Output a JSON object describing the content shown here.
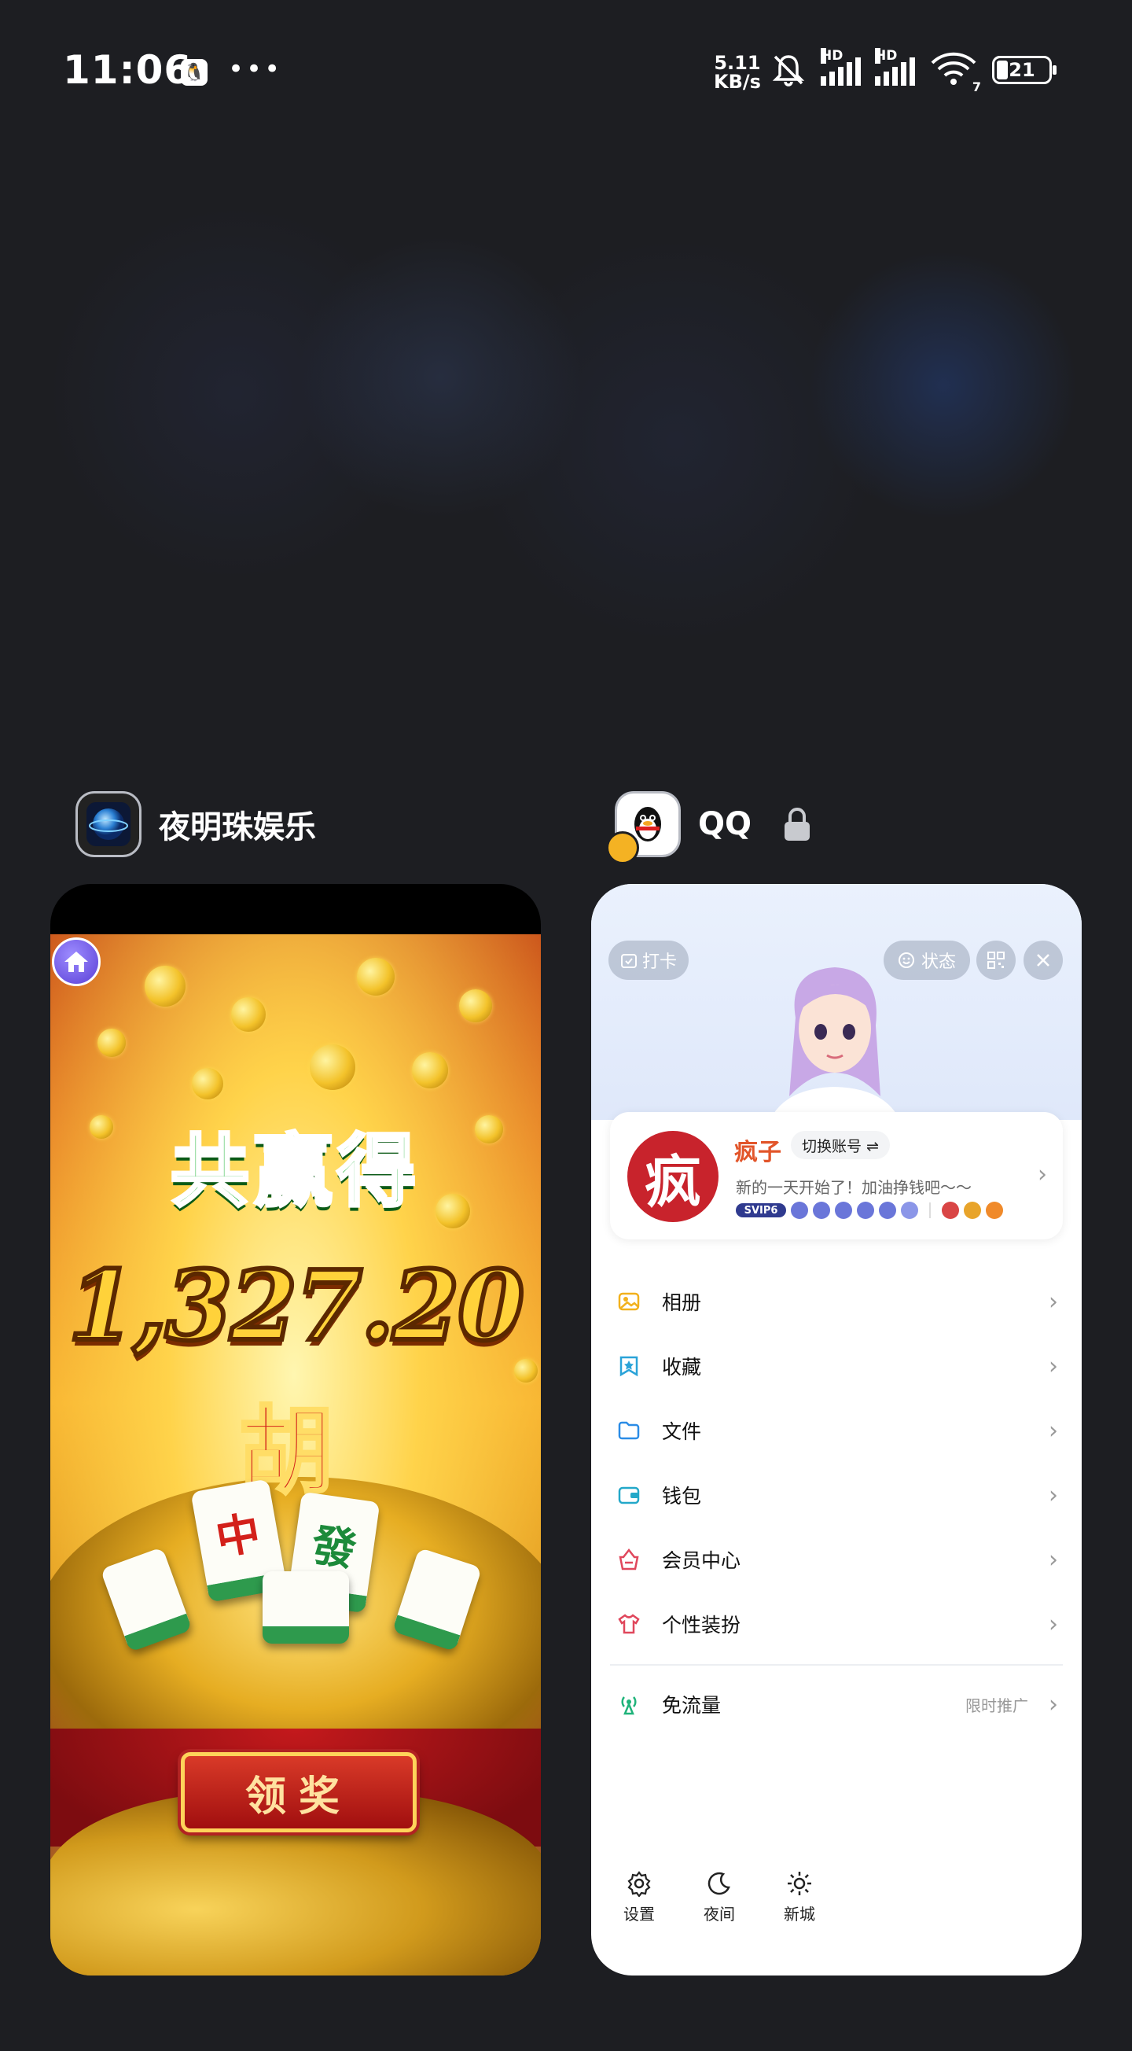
{
  "status_bar": {
    "time": "11:06",
    "app_icon": "qq-penguin",
    "more": "•••",
    "net_speed_value": "5.11",
    "net_speed_unit": "KB/s",
    "hd1": "HD",
    "hd2": "HD",
    "wifi_sub": "7",
    "battery": "21"
  },
  "recent_apps": [
    {
      "name": "夜明珠娱乐",
      "icon": "globe-pearl-icon",
      "game": {
        "headline": "共赢得",
        "amount": "1,327.20",
        "hu": "胡",
        "tile_1": "中",
        "tile_2": "發",
        "claim_button": "领奖"
      }
    },
    {
      "name": "QQ",
      "icon": "qq-penguin-icon",
      "locked": true,
      "qq": {
        "checkin": "打卡",
        "status": "状态",
        "nickname": "疯子",
        "avatar_char": "疯",
        "switch_account": "切换账号 ⇌",
        "signature": "新的一天开始了！加油挣钱吧～～",
        "vip_label": "SVIP6",
        "menu": [
          {
            "label": "相册",
            "icon": "album-icon"
          },
          {
            "label": "收藏",
            "icon": "favorites-icon"
          },
          {
            "label": "文件",
            "icon": "folder-icon"
          },
          {
            "label": "钱包",
            "icon": "wallet-icon"
          },
          {
            "label": "会员中心",
            "icon": "vip-center-icon"
          },
          {
            "label": "个性装扮",
            "icon": "shirt-icon"
          }
        ],
        "free_data": {
          "label": "免流量",
          "note": "限时推广"
        },
        "bottom": [
          {
            "label": "设置",
            "icon": "gear-icon"
          },
          {
            "label": "夜间",
            "icon": "moon-icon"
          },
          {
            "label": "新城",
            "icon": "sun-icon"
          }
        ]
      }
    }
  ]
}
